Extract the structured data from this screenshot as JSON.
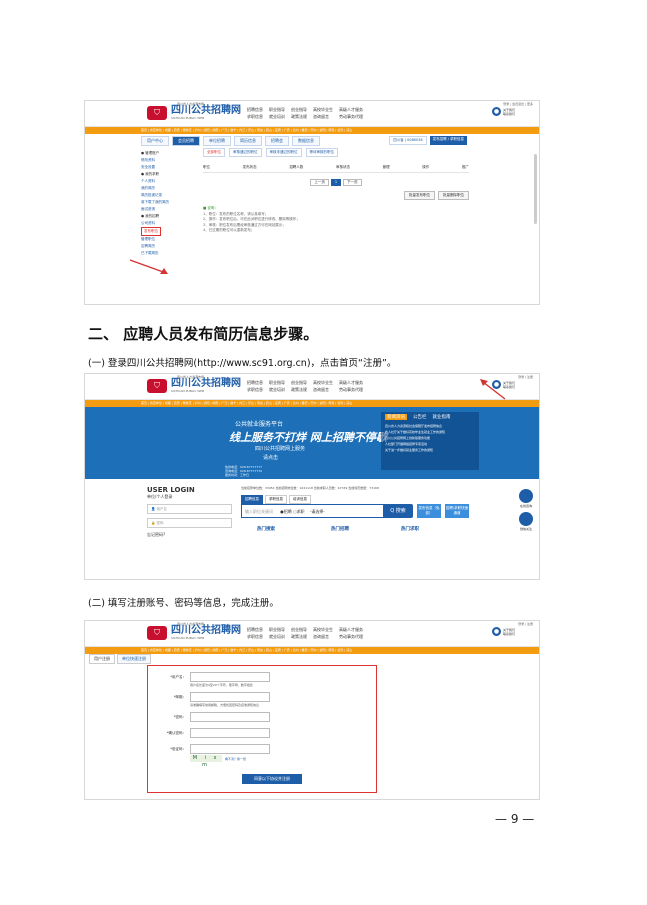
{
  "section_heading": "二、 应聘人员发布简历信息步骤。",
  "step1": "(一) 登录四川公共招聘网(http://www.sc91.org.cn)，点击首页“注册”。",
  "step2": "(二) 填写注册账号、密码等信息，完成注册。",
  "page_number": "— 9 —",
  "colors": {
    "brand_blue": "#1e5da8",
    "orange": "#f39c12",
    "red": "#d33333"
  },
  "site": {
    "name": "四川公共招聘网",
    "name_en": "SICHUAN PUBLIC WEB",
    "tagline": "四川省人力资源市场",
    "nav_col1": [
      "招聘信息",
      "求职信息"
    ],
    "nav_col2": [
      "职业指导",
      "就业培训"
    ],
    "nav_col3": [
      "创业指导",
      "政策法规"
    ],
    "nav_col4": [
      "高校毕业生",
      "咨询留言"
    ],
    "nav_col5": [
      "高级人才服务",
      "劳动事务代理"
    ],
    "about_line1": "关于我们",
    "about_line2": "联系我们",
    "top_right_1": "登录 | 会员退出 | 更多",
    "top_right_2": "登录 | 注册",
    "menu_bar": "首页 | 省直单位 | 成都 | 自贡 | 攀枝花 | 泸州 | 德阳 | 绵阳 | 广元 | 遂宁 | 内江 | 乐山 | 南充 | 眉山 | 宜宾 | 广安 | 达州 | 雅安 | 巴中 | 资阳 | 阿坝 | 甘孜 | 凉山"
  },
  "shot1": {
    "top_tabs": [
      "用户中心",
      "会员招聘",
      "单位招聘",
      "简历信息",
      "招聘会",
      "数据信息"
    ],
    "top_right_buttons": [
      "四川省 | 0086036",
      "发布招聘 / 求职信息"
    ],
    "sidebar": [
      {
        "text": "● 管理账户",
        "group": true
      },
      {
        "text": "修改资料",
        "group": false
      },
      {
        "text": "安全设置",
        "group": false
      },
      {
        "text": "● 我的求职",
        "group": true
      },
      {
        "text": "个人资料",
        "group": false
      },
      {
        "text": "我的简历",
        "group": false
      },
      {
        "text": "简历投递记录",
        "group": false
      },
      {
        "text": "谁下载了我的简历",
        "group": false
      },
      {
        "text": "面试邀请",
        "group": false
      },
      {
        "text": "● 我的招聘",
        "group": true
      },
      {
        "text": "公司资料",
        "group": false
      },
      {
        "text": "发布职位",
        "group": false,
        "highlight": true
      },
      {
        "text": "管理职位",
        "group": false
      },
      {
        "text": "应聘简历",
        "group": false
      },
      {
        "text": "已下载简历",
        "group": false
      }
    ],
    "subtabs": [
      "全部职位",
      "审核通过的职位",
      "审核未通过的职位",
      "等待审核的职位"
    ],
    "table_headers": [
      "职位",
      "发布状态",
      "招聘人数",
      "审核状态",
      "管理",
      "操作",
      "推广"
    ],
    "pager": [
      "上一页",
      "1",
      "下一页"
    ],
    "buttons": [
      "批量发布职位",
      "批量删除职位"
    ],
    "notes": [
      "■ 说明：",
      "1、职位：发布的职位名称，请认真填写；",
      "2、操作：发布职位后，可在此对职位进行修改、删除等操作；",
      "3、审核：职位发布后需经审核通过方可在网站展示；",
      "4、已过期的职位可以重新发布；"
    ]
  },
  "shot2": {
    "banner_line1": "公共就业服务平台",
    "banner_line2": "线上服务不打烊 网上招聘不停歇",
    "banner_line3": "四川公共招聘网上服务",
    "banner_line4": "请点击",
    "banner_info": [
      "热线电话：028-87777777",
      "咨询电话：028-87777770",
      "服务时间：工作日"
    ],
    "news_tabs": [
      "新闻资讯",
      "公告栏",
      "就业指南"
    ],
    "news_items": [
      "四川省人力资源和社会保障厅发布招聘信息",
      "省人社厅关于做好高校毕业生就业工作的通知",
      "四川公共招聘网上线新版服务功能",
      "人社部门开展网络招聘专项活动",
      "关于进一步做好就业服务工作的通知"
    ],
    "login_title": "USER LOGIN",
    "login_sub": "单位/个人登录",
    "username_placeholder": "用户名",
    "password_placeholder": "密码",
    "forgot": "忘记密码?",
    "stats": "当前招聘单位数：33954    当前招聘岗位数：1021118    当前求职人员数：67339    当前简历数量：73168",
    "search_tabs": [
      "招聘信息",
      "求职信息",
      "培训信息"
    ],
    "search_placeholder": "输入职位关键词",
    "search_options": "●招聘 ○求职",
    "select_label": "-请选择-",
    "search_button": "Q 搜索",
    "publish_button": "发布信息（免费）",
    "recruit_button": "招聘/求职快速通道",
    "sections": [
      "热门搜索",
      "热门招聘",
      "热门求职"
    ],
    "side_icons": [
      "在线咨询",
      "微信关注"
    ]
  },
  "shot3": {
    "tabs": [
      "用户注册",
      "单位快速注册"
    ],
    "fields": [
      {
        "label": "*用户名：",
        "hint": "用户名长度为4至20个字符，限字母、数字组合"
      },
      {
        "label": "*邮箱：",
        "hint": "请准确填写常用邮箱，方便找回密码及接收通知信息"
      },
      {
        "label": "*密码：",
        "hint": ""
      },
      {
        "label": "*确认密码：",
        "hint": ""
      },
      {
        "label": "*验证码：",
        "hint": ""
      }
    ],
    "captcha_text": "M i s m",
    "captcha_refresh": "看不清？换一张",
    "submit_label": "同意以下协议并注册"
  }
}
